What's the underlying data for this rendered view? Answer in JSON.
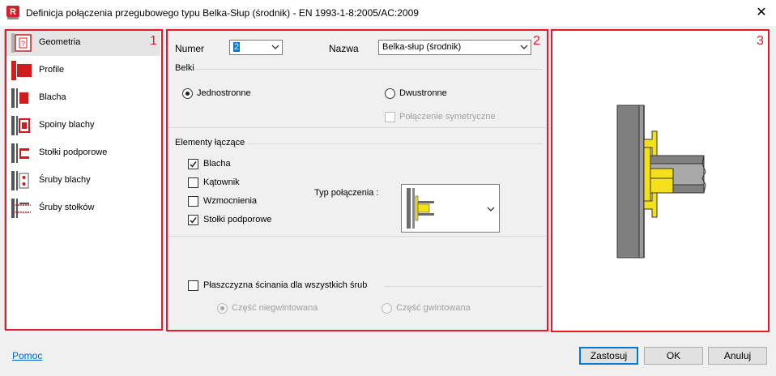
{
  "window": {
    "title": "Definicja połączenia przegubowego typu Belka-Słup (środnik) - EN 1993-1-8:2005/AC:2009",
    "app_icon_letter": "R",
    "close_glyph": "✕"
  },
  "regions": {
    "left": "1",
    "middle": "2",
    "preview": "3"
  },
  "nav": {
    "items": [
      {
        "label": "Geometria",
        "selected": true
      },
      {
        "label": "Profile"
      },
      {
        "label": "Blacha"
      },
      {
        "label": "Spoiny blachy"
      },
      {
        "label": "Stołki podporowe"
      },
      {
        "label": "Śruby blachy"
      },
      {
        "label": "Śruby stołków"
      }
    ]
  },
  "form": {
    "numer_label": "Numer",
    "numer_value": "2",
    "nazwa_label": "Nazwa",
    "nazwa_value": "Belka-słup (środnik)",
    "belki_group": "Belki",
    "jednostronne": "Jednostronne",
    "dwustronne": "Dwustronne",
    "symetryczne": "Połączenie symetryczne",
    "elements_group": "Elementy łączące",
    "blacha": "Blacha",
    "katownik": "Kątownik",
    "wzmocnienia": "Wzmocnienia",
    "stolki": "Stołki podporowe",
    "typ_label": "Typ połączenia :",
    "plaszczyzna": "Płaszczyzna ścinania dla wszystkich śrub",
    "niegwintowana": "Część niegwintowana",
    "gwintowana": "Część gwintowana",
    "state": {
      "jednostronne": true,
      "dwustronne": false,
      "symetryczne": false,
      "blacha": true,
      "katownik": false,
      "wzmocnienia": false,
      "stolki": true,
      "plaszczyzna": false,
      "niegwintowana": true
    }
  },
  "footer": {
    "help": "Pomoc",
    "apply": "Zastosuj",
    "ok": "OK",
    "cancel": "Anuluj"
  },
  "colors": {
    "accent_red": "#e8182a",
    "steel_gray": "#7f7f7f",
    "plate_yellow": "#f5e01c",
    "link_blue": "#0066cc",
    "focus_blue": "#0078d7"
  },
  "icons": {
    "app": "robot-app-icon",
    "close": "close-icon",
    "combo": "chevron-down-icon"
  }
}
